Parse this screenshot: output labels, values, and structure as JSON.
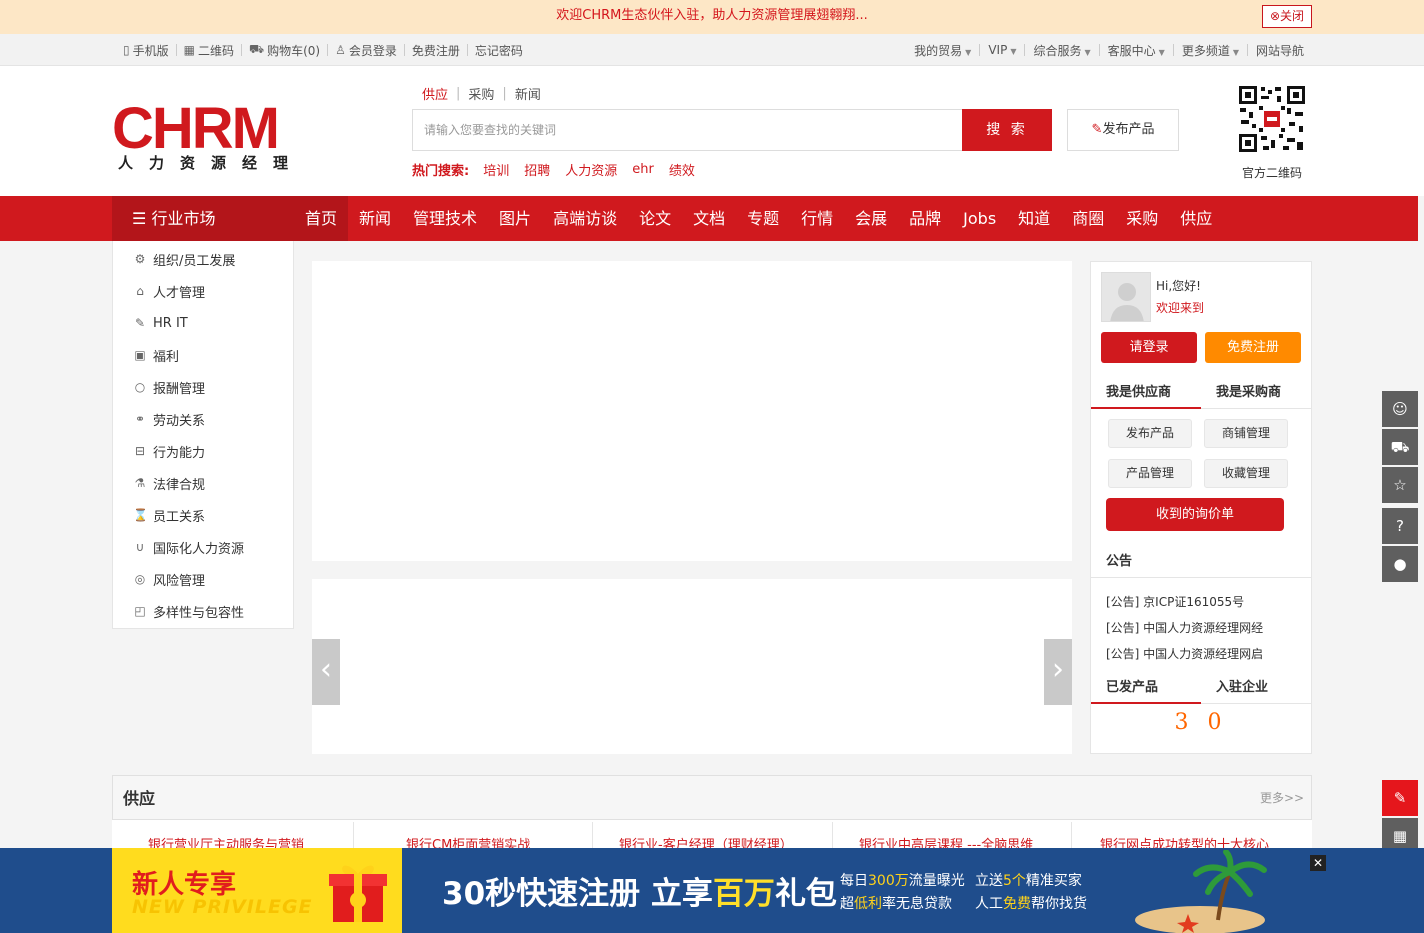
{
  "banner": {
    "text": "欢迎CHRM生态伙伴入驻，助人力资源管理展翅翱翔...",
    "close_label": "关闭"
  },
  "topbar": {
    "left": [
      {
        "icon": "mobile-icon",
        "label": "手机版"
      },
      {
        "icon": "qrcode-icon",
        "label": "二维码"
      },
      {
        "icon": "cart-icon",
        "label": "购物车(0)"
      },
      {
        "icon": "user-icon",
        "label": "会员登录"
      },
      {
        "icon": "",
        "label": "免费注册"
      },
      {
        "icon": "",
        "label": "忘记密码"
      }
    ],
    "right": [
      "我的贸易",
      "VIP",
      "综合服务",
      "客服中心",
      "更多频道",
      "网站导航"
    ]
  },
  "logo": {
    "word": "CHRM",
    "sub": "人力资源经理"
  },
  "search": {
    "tabs": [
      "供应",
      "采购",
      "新闻"
    ],
    "placeholder": "请输入您要查找的关键词",
    "button": "搜 索",
    "publish": "发布产品",
    "hot_label": "热门搜索:",
    "hot_keywords": [
      "培训",
      "招聘",
      "人力资源",
      "ehr",
      "绩效"
    ]
  },
  "qr_caption": "官方二维码",
  "nav": {
    "category": "行业市场",
    "items": [
      "首页",
      "新闻",
      "管理技术",
      "图片",
      "高端访谈",
      "论文",
      "文档",
      "专题",
      "行情",
      "会展",
      "品牌",
      "Jobs",
      "知道",
      "商圈",
      "采购",
      "供应"
    ]
  },
  "sidebar": [
    {
      "icon": "gear-icon",
      "label": "组织/员工发展"
    },
    {
      "icon": "briefcase-icon",
      "label": "人才管理"
    },
    {
      "icon": "pen-icon",
      "label": "HR IT"
    },
    {
      "icon": "gift-icon",
      "label": "福利"
    },
    {
      "icon": "apple-icon",
      "label": "报酬管理"
    },
    {
      "icon": "handshake-icon",
      "label": "劳动关系"
    },
    {
      "icon": "car-icon",
      "label": "行为能力"
    },
    {
      "icon": "flask-icon",
      "label": "法律合规"
    },
    {
      "icon": "hourglass-icon",
      "label": "员工关系"
    },
    {
      "icon": "magnet-icon",
      "label": "国际化人力资源"
    },
    {
      "icon": "piggy-icon",
      "label": "风险管理"
    },
    {
      "icon": "picture-icon",
      "label": "多样性与包容性"
    }
  ],
  "user": {
    "hi": "Hi,您好!",
    "welcome": "欢迎来到",
    "login": "请登录",
    "register": "免费注册",
    "tabs": [
      "我是供应商",
      "我是采购商"
    ],
    "actions": [
      "发布产品",
      "商铺管理",
      "产品管理",
      "收藏管理"
    ],
    "inquiry": "收到的询价单",
    "notice_title": "公告",
    "notices": [
      "[公告] 京ICP证161055号",
      "[公告] 中国人力资源经理网经",
      "[公告] 中国人力资源经理网启"
    ],
    "stat_tabs": [
      "已发产品",
      "入驻企业"
    ],
    "stat_values": "3 0"
  },
  "supply": {
    "title": "供应",
    "more": "更多>>",
    "items": [
      "银行营业厅主动服务与营销",
      "银行CM柜面营销实战",
      "银行业-客户经理（理财经理）",
      "银行业中高层课程 ---全脑思维",
      "银行网点成功转型的十大核心"
    ]
  },
  "floating": [
    "user-circle-icon",
    "cart-icon",
    "star-icon",
    "help-icon",
    "service-icon",
    "edit-icon",
    "qrcode-icon",
    "arrow-down-icon"
  ],
  "promo": {
    "left_title": "新人专享",
    "left_sub": "NEW PRIVILEGE",
    "main_pre": "30秒快速注册 立享",
    "main_hl": "百万",
    "main_post": "礼包",
    "line1_a": "每日",
    "line1_hl": "300万",
    "line1_b": "流量曝光",
    "line2_a": "超",
    "line2_hl": "低利",
    "line2_b": "率无息贷款",
    "line3_a": "立送",
    "line3_hl": "5个",
    "line3_b": "精准买家",
    "line4_a": "人工",
    "line4_hl": "免费",
    "line4_b": "帮你找货",
    "close": "✕"
  }
}
